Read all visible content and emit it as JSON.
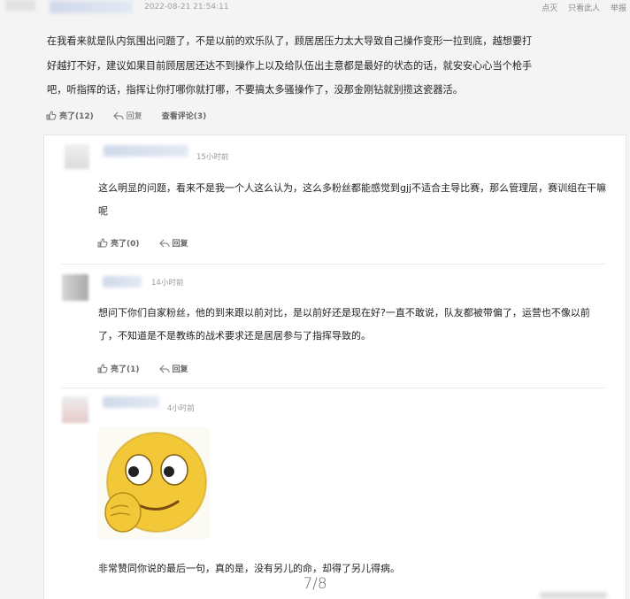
{
  "main_comment": {
    "time": "2022-08-21 21:54:11",
    "links": [
      "点灭",
      "只看此人",
      "举报"
    ],
    "text": "在我看来就是队内氛围出问题了，不是以前的欢乐队了，顾居居压力太大导致自己操作变形一拉到底，越想要打好越打不好，建议如果目前顾居居还达不到操作上以及给队伍出主意都是最好的状态的话，就安安心心当个枪手吧，听指挥的话，指挥让你打哪你就打哪，不要搞太多骚操作了，没那金刚钻就别揽这瓷器活。",
    "like_label": "亮了(12)",
    "reply_label": "回复",
    "view_replies_label": "查看评论(3)"
  },
  "replies": [
    {
      "time": "15小时前",
      "text": "这么明显的问题，看来不是我一个人这么认为，这么多粉丝都能感觉到gjj不适合主导比赛，那么管理层，赛训组在干嘛呢",
      "like_label": "亮了(0)",
      "reply_label": "回复"
    },
    {
      "time": "14小时前",
      "text": "想问下你们自家粉丝，他的到来跟以前对比，是以前好还是现在好?一直不敢说，队友都被带偏了，运营也不像以前了，不知道是不是教练的战术要求还是居居参与了指挥导致的。",
      "like_label": "亮了(1)",
      "reply_label": "回复"
    },
    {
      "time": "4小时前",
      "text": "非常赞同你说的最后一句，真的是，没有另儿的命，却得了另儿得病。"
    }
  ],
  "page_indicator": "7/8",
  "colors": {
    "background": "#f4f4f4",
    "card": "#ffffff",
    "text": "#222222",
    "muted": "#9a9a9a"
  }
}
